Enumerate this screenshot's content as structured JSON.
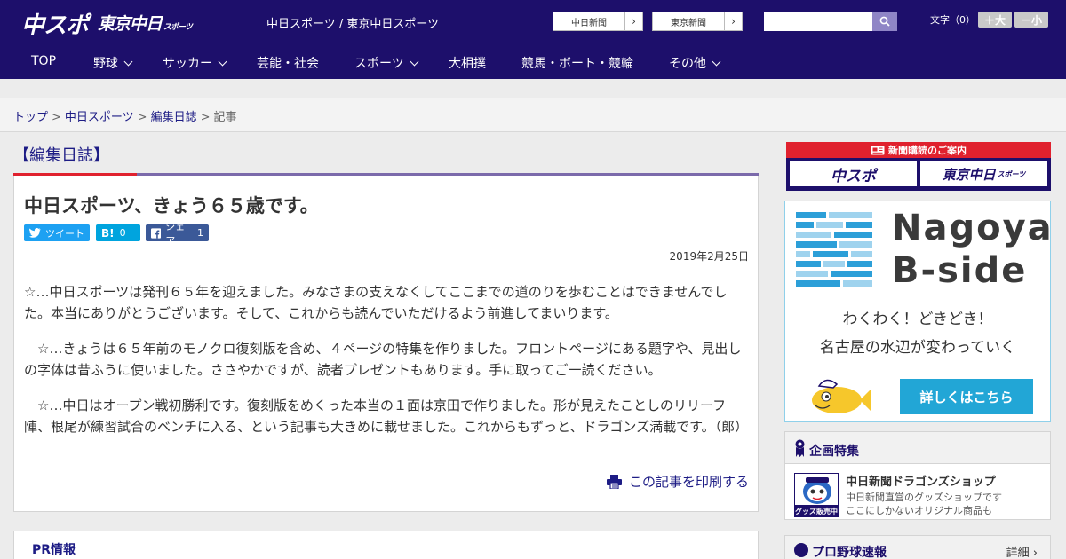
{
  "header": {
    "logo_chuspo": "中スポ",
    "logo_tokyo": "東京中日",
    "logo_tokyo_sub": "スポーツ",
    "site_title": "中日スポーツ / 東京中日スポーツ",
    "newspaper_links": [
      {
        "label": "中日新聞",
        "arrow": "›"
      },
      {
        "label": "東京新聞",
        "arrow": "›"
      }
    ],
    "search": {
      "placeholder": ""
    },
    "font_size_label": "文字（0）",
    "font_larger": "＋大",
    "font_smaller": "－小"
  },
  "nav": {
    "items": [
      {
        "label": "TOP",
        "dropdown": false
      },
      {
        "label": "野球",
        "dropdown": true
      },
      {
        "label": "サッカー",
        "dropdown": true
      },
      {
        "label": "芸能・社会",
        "dropdown": false
      },
      {
        "label": "スポーツ",
        "dropdown": true
      },
      {
        "label": "大相撲",
        "dropdown": false
      },
      {
        "label": "競馬・ボート・競輪",
        "dropdown": false
      },
      {
        "label": "その他",
        "dropdown": true
      }
    ]
  },
  "breadcrumb": {
    "items": [
      "トップ",
      "中日スポーツ",
      "編集日誌"
    ],
    "current": "記事",
    "separator": ">"
  },
  "section": {
    "title": "【編集日誌】"
  },
  "article": {
    "title": "中日スポーツ、きょう６５歳です。",
    "share": {
      "tweet": "ツイート",
      "hatena_icon": "B!",
      "hatena_count": "0",
      "facebook_label": "シェア",
      "facebook_count": "1"
    },
    "date": "2019年2月25日",
    "paragraphs": [
      "☆…中日スポーツは発刊６５年を迎えました。みなさまの支えなくしてここまでの道のりを歩むことはできませんでした。本当にありがとうございます。そして、これからも読んでいただけるよう前進してまいります。",
      "　☆…きょうは６５年前のモノクロ復刻版を含め、４ページの特集を作りました。フロントページにある題字や、見出しの字体は昔ふうに使いました。ささやかですが、読者プレゼントもあります。手に取ってご一読ください。",
      "　☆…中日はオープン戦初勝利です。復刻版をめくった本当の１面は京田で作りました。形が見えたことしのリリーフ陣、根尾が練習試合のベンチに入る、という記事も大きめに載せました。これからもずっと、ドラゴンズ満載です。（郎）"
    ],
    "print_label": "この記事を印刷する"
  },
  "pr": {
    "title": "PR情報"
  },
  "sidebar": {
    "subscription": {
      "heading": "新聞購読のご案内",
      "left": "中スポ",
      "right": "東京中日",
      "right_sub": "スポーツ"
    },
    "ad": {
      "brand_line1": "Nagoya",
      "brand_line2": "B-side",
      "tagline1": "わくわく！どきどき！",
      "tagline2": "名古屋の水辺が変わっていく",
      "cta": "詳しくはこちら"
    },
    "feature": {
      "title": "企画特集",
      "shop_name": "中日新聞ドラゴンズショップ",
      "shop_desc1": "中日新聞直営のグッズショップです",
      "shop_desc2": "ここにしかないオリジナル商品も",
      "thumb_label": "グッズ販売中"
    },
    "scores": {
      "title": "プロ野球速報",
      "more": "詳細 ›"
    }
  },
  "colors": {
    "header_bg": "#1d0f6b",
    "accent_red": "#e0212e",
    "link": "#1d1c85",
    "twitter": "#1da1f2",
    "hatena": "#00a4de",
    "facebook": "#3b5998",
    "ad_cta": "#22a6d6"
  }
}
